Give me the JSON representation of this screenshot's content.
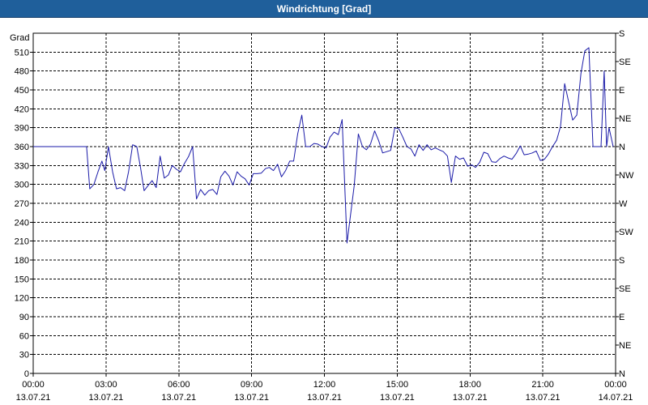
{
  "window": {
    "title": "Windrichtung [Grad]"
  },
  "chart_data": {
    "type": "line",
    "title": "Windrichtung [Grad]",
    "ylabel": "Grad",
    "xlabel": "",
    "ylim": [
      0,
      525
    ],
    "xlim_hours": [
      0,
      24
    ],
    "grid": true,
    "yticks": [
      0,
      30,
      60,
      90,
      120,
      150,
      180,
      210,
      240,
      270,
      300,
      330,
      360,
      390,
      420,
      450,
      480,
      510
    ],
    "right_axis_labels": [
      {
        "value": 0,
        "label": "N"
      },
      {
        "value": 45,
        "label": "NE"
      },
      {
        "value": 90,
        "label": "E"
      },
      {
        "value": 135,
        "label": "SE"
      },
      {
        "value": 180,
        "label": "S"
      },
      {
        "value": 225,
        "label": "SW"
      },
      {
        "value": 270,
        "label": "W"
      },
      {
        "value": 315,
        "label": "NW"
      },
      {
        "value": 360,
        "label": "N"
      },
      {
        "value": 405,
        "label": "NE"
      },
      {
        "value": 450,
        "label": "E"
      },
      {
        "value": 495,
        "label": "SE"
      },
      {
        "value": 540,
        "label": "S"
      }
    ],
    "xticks": [
      {
        "hour": 0,
        "time": "00:00",
        "date": "13.07.21"
      },
      {
        "hour": 3,
        "time": "03:00",
        "date": "13.07.21"
      },
      {
        "hour": 6,
        "time": "06:00",
        "date": "13.07.21"
      },
      {
        "hour": 9,
        "time": "09:00",
        "date": "13.07.21"
      },
      {
        "hour": 12,
        "time": "12:00",
        "date": "13.07.21"
      },
      {
        "hour": 15,
        "time": "15:00",
        "date": "13.07.21"
      },
      {
        "hour": 18,
        "time": "18:00",
        "date": "13.07.21"
      },
      {
        "hour": 21,
        "time": "21:00",
        "date": "13.07.21"
      },
      {
        "hour": 24,
        "time": "00:00",
        "date": "14.07.21"
      }
    ],
    "series": [
      {
        "color": "#1a1aa8",
        "points": [
          [
            0.0,
            360
          ],
          [
            2.2,
            360
          ],
          [
            2.33,
            293
          ],
          [
            2.5,
            300
          ],
          [
            2.67,
            320
          ],
          [
            2.83,
            337
          ],
          [
            2.95,
            322
          ],
          [
            3.1,
            360
          ],
          [
            3.27,
            320
          ],
          [
            3.43,
            293
          ],
          [
            3.6,
            295
          ],
          [
            3.77,
            290
          ],
          [
            3.93,
            320
          ],
          [
            4.1,
            363
          ],
          [
            4.27,
            360
          ],
          [
            4.43,
            325
          ],
          [
            4.57,
            290
          ],
          [
            4.73,
            298
          ],
          [
            4.9,
            306
          ],
          [
            5.07,
            295
          ],
          [
            5.23,
            345
          ],
          [
            5.4,
            310
          ],
          [
            5.57,
            315
          ],
          [
            5.73,
            330
          ],
          [
            5.9,
            324
          ],
          [
            6.07,
            320
          ],
          [
            6.23,
            333
          ],
          [
            6.4,
            344
          ],
          [
            6.57,
            360
          ],
          [
            6.73,
            277
          ],
          [
            6.9,
            292
          ],
          [
            7.07,
            283
          ],
          [
            7.23,
            290
          ],
          [
            7.4,
            292
          ],
          [
            7.57,
            284
          ],
          [
            7.73,
            312
          ],
          [
            7.9,
            321
          ],
          [
            8.07,
            313
          ],
          [
            8.23,
            299
          ],
          [
            8.4,
            320
          ],
          [
            8.57,
            313
          ],
          [
            8.73,
            309
          ],
          [
            8.9,
            299
          ],
          [
            9.07,
            317
          ],
          [
            9.23,
            317
          ],
          [
            9.4,
            318
          ],
          [
            9.57,
            325
          ],
          [
            9.73,
            327
          ],
          [
            9.9,
            322
          ],
          [
            10.07,
            332
          ],
          [
            10.23,
            312
          ],
          [
            10.4,
            322
          ],
          [
            10.57,
            337
          ],
          [
            10.73,
            337
          ],
          [
            10.9,
            380
          ],
          [
            11.07,
            410
          ],
          [
            11.23,
            360
          ],
          [
            11.4,
            360
          ],
          [
            11.57,
            365
          ],
          [
            11.73,
            364
          ],
          [
            11.9,
            360
          ],
          [
            12.07,
            358
          ],
          [
            12.23,
            375
          ],
          [
            12.4,
            383
          ],
          [
            12.57,
            379
          ],
          [
            12.73,
            403
          ],
          [
            12.93,
            207
          ],
          [
            13.07,
            250
          ],
          [
            13.23,
            298
          ],
          [
            13.4,
            380
          ],
          [
            13.57,
            360
          ],
          [
            13.73,
            355
          ],
          [
            13.9,
            364
          ],
          [
            14.07,
            385
          ],
          [
            14.23,
            370
          ],
          [
            14.4,
            350
          ],
          [
            14.57,
            352
          ],
          [
            14.73,
            354
          ],
          [
            14.9,
            390
          ],
          [
            15.07,
            388
          ],
          [
            15.23,
            375
          ],
          [
            15.4,
            360
          ],
          [
            15.57,
            356
          ],
          [
            15.73,
            345
          ],
          [
            15.9,
            363
          ],
          [
            16.07,
            354
          ],
          [
            16.23,
            363
          ],
          [
            16.4,
            355
          ],
          [
            16.57,
            358
          ],
          [
            16.73,
            355
          ],
          [
            16.9,
            352
          ],
          [
            17.07,
            345
          ],
          [
            17.23,
            303
          ],
          [
            17.4,
            345
          ],
          [
            17.57,
            340
          ],
          [
            17.73,
            342
          ],
          [
            17.9,
            329
          ],
          [
            18.07,
            331
          ],
          [
            18.23,
            327
          ],
          [
            18.4,
            335
          ],
          [
            18.57,
            351
          ],
          [
            18.73,
            349
          ],
          [
            18.9,
            336
          ],
          [
            19.07,
            335
          ],
          [
            19.23,
            341
          ],
          [
            19.4,
            345
          ],
          [
            19.57,
            342
          ],
          [
            19.73,
            340
          ],
          [
            19.9,
            349
          ],
          [
            20.07,
            361
          ],
          [
            20.23,
            347
          ],
          [
            20.4,
            348
          ],
          [
            20.57,
            350
          ],
          [
            20.73,
            353
          ],
          [
            20.9,
            338
          ],
          [
            21.07,
            340
          ],
          [
            21.23,
            348
          ],
          [
            21.4,
            360
          ],
          [
            21.57,
            370
          ],
          [
            21.73,
            392
          ],
          [
            21.9,
            460
          ],
          [
            22.07,
            430
          ],
          [
            22.23,
            402
          ],
          [
            22.4,
            410
          ],
          [
            22.57,
            476
          ],
          [
            22.73,
            512
          ],
          [
            22.9,
            517
          ],
          [
            23.07,
            360
          ],
          [
            23.23,
            360
          ],
          [
            23.4,
            360
          ],
          [
            23.53,
            480
          ],
          [
            23.63,
            360
          ],
          [
            23.73,
            390
          ],
          [
            23.9,
            360
          ]
        ]
      }
    ]
  }
}
